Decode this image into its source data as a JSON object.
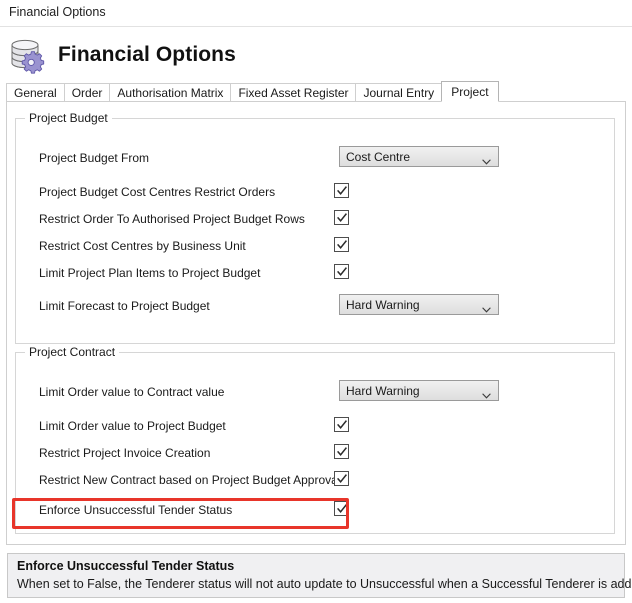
{
  "window": {
    "title": "Financial Options"
  },
  "header": {
    "icon": "database-gear-icon",
    "heading": "Financial Options"
  },
  "tabs": [
    {
      "label": "General",
      "selected": false
    },
    {
      "label": "Order",
      "selected": false
    },
    {
      "label": "Authorisation Matrix",
      "selected": false
    },
    {
      "label": "Fixed Asset Register",
      "selected": false
    },
    {
      "label": "Journal Entry",
      "selected": false
    },
    {
      "label": "Project",
      "selected": true
    }
  ],
  "groups": [
    {
      "caption": "Project Budget",
      "rows": [
        {
          "label": "Project Budget From",
          "control": "combo",
          "value": "Cost Centre"
        },
        {
          "label": "Project Budget Cost Centres Restrict Orders",
          "control": "checkbox",
          "checked": true
        },
        {
          "label": "Restrict Order To Authorised Project Budget Rows",
          "control": "checkbox",
          "checked": true
        },
        {
          "label": "Restrict Cost Centres by Business Unit",
          "control": "checkbox",
          "checked": true
        },
        {
          "label": "Limit Project Plan Items to Project Budget",
          "control": "checkbox",
          "checked": true
        },
        {
          "label": "Limit Forecast to Project Budget",
          "control": "combo",
          "value": "Hard Warning"
        }
      ]
    },
    {
      "caption": "Project Contract",
      "rows": [
        {
          "label": "Limit Order value to Contract value",
          "control": "combo",
          "value": "Hard Warning"
        },
        {
          "label": "Limit Order value to Project Budget",
          "control": "checkbox",
          "checked": true
        },
        {
          "label": "Restrict Project Invoice Creation",
          "control": "checkbox",
          "checked": true
        },
        {
          "label": "Restrict New Contract based on Project Budget Approval",
          "control": "checkbox",
          "checked": true
        },
        {
          "label": "Enforce Unsuccessful Tender Status",
          "control": "checkbox",
          "checked": true,
          "highlighted": true
        }
      ]
    }
  ],
  "highlight": {
    "color": "#e8352a",
    "target_label": "Enforce Unsuccessful Tender Status"
  },
  "description": {
    "title": "Enforce Unsuccessful Tender Status",
    "body": "When set to False, the Tenderer status will not auto update to Unsuccessful when a Successful Tenderer is added."
  }
}
